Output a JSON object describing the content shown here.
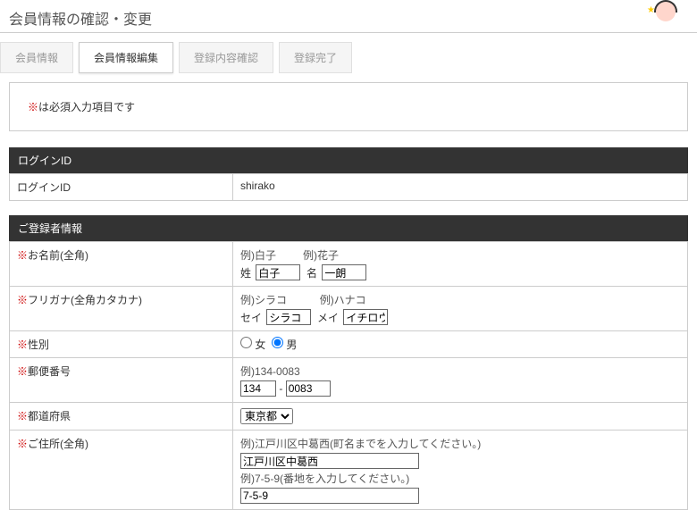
{
  "header": {
    "title": "会員情報の確認・変更"
  },
  "steps": {
    "s1": "会員情報",
    "s2": "会員情報編集",
    "s3": "登録内容確認",
    "s4": "登録完了"
  },
  "notice": {
    "req_mark": "※",
    "text": "は必須入力項目です"
  },
  "login_section": {
    "head": "ログインID",
    "label": "ログインID",
    "value": "shirako"
  },
  "reg_section": {
    "head": "ご登録者情報"
  },
  "name": {
    "label": "お名前(全角)",
    "ex_sei": "例)白子",
    "ex_mei": "例)花子",
    "sei_label": "姓",
    "mei_label": "名",
    "sei_value": "白子",
    "mei_value": "一朗"
  },
  "kana": {
    "label": "フリガナ(全角カタカナ)",
    "ex_sei": "例)シラコ",
    "ex_mei": "例)ハナコ",
    "sei_label": "セイ",
    "mei_label": "メイ",
    "sei_value": "シラコ",
    "mei_value": "イチロウ"
  },
  "gender": {
    "label": "性別",
    "female": "女",
    "male": "男"
  },
  "postal": {
    "label": "郵便番号",
    "example": "例)134-0083",
    "dash": "-",
    "value1": "134",
    "value2": "0083"
  },
  "pref": {
    "label": "都道府県",
    "value": "東京都"
  },
  "address": {
    "label": "ご住所(全角)",
    "ex1": "例)江戸川区中葛西(町名までを入力してください。)",
    "ex2": "例)7-5-9(番地を入力してください。)",
    "value1": "江戸川区中葛西",
    "value2": "7-5-9"
  }
}
